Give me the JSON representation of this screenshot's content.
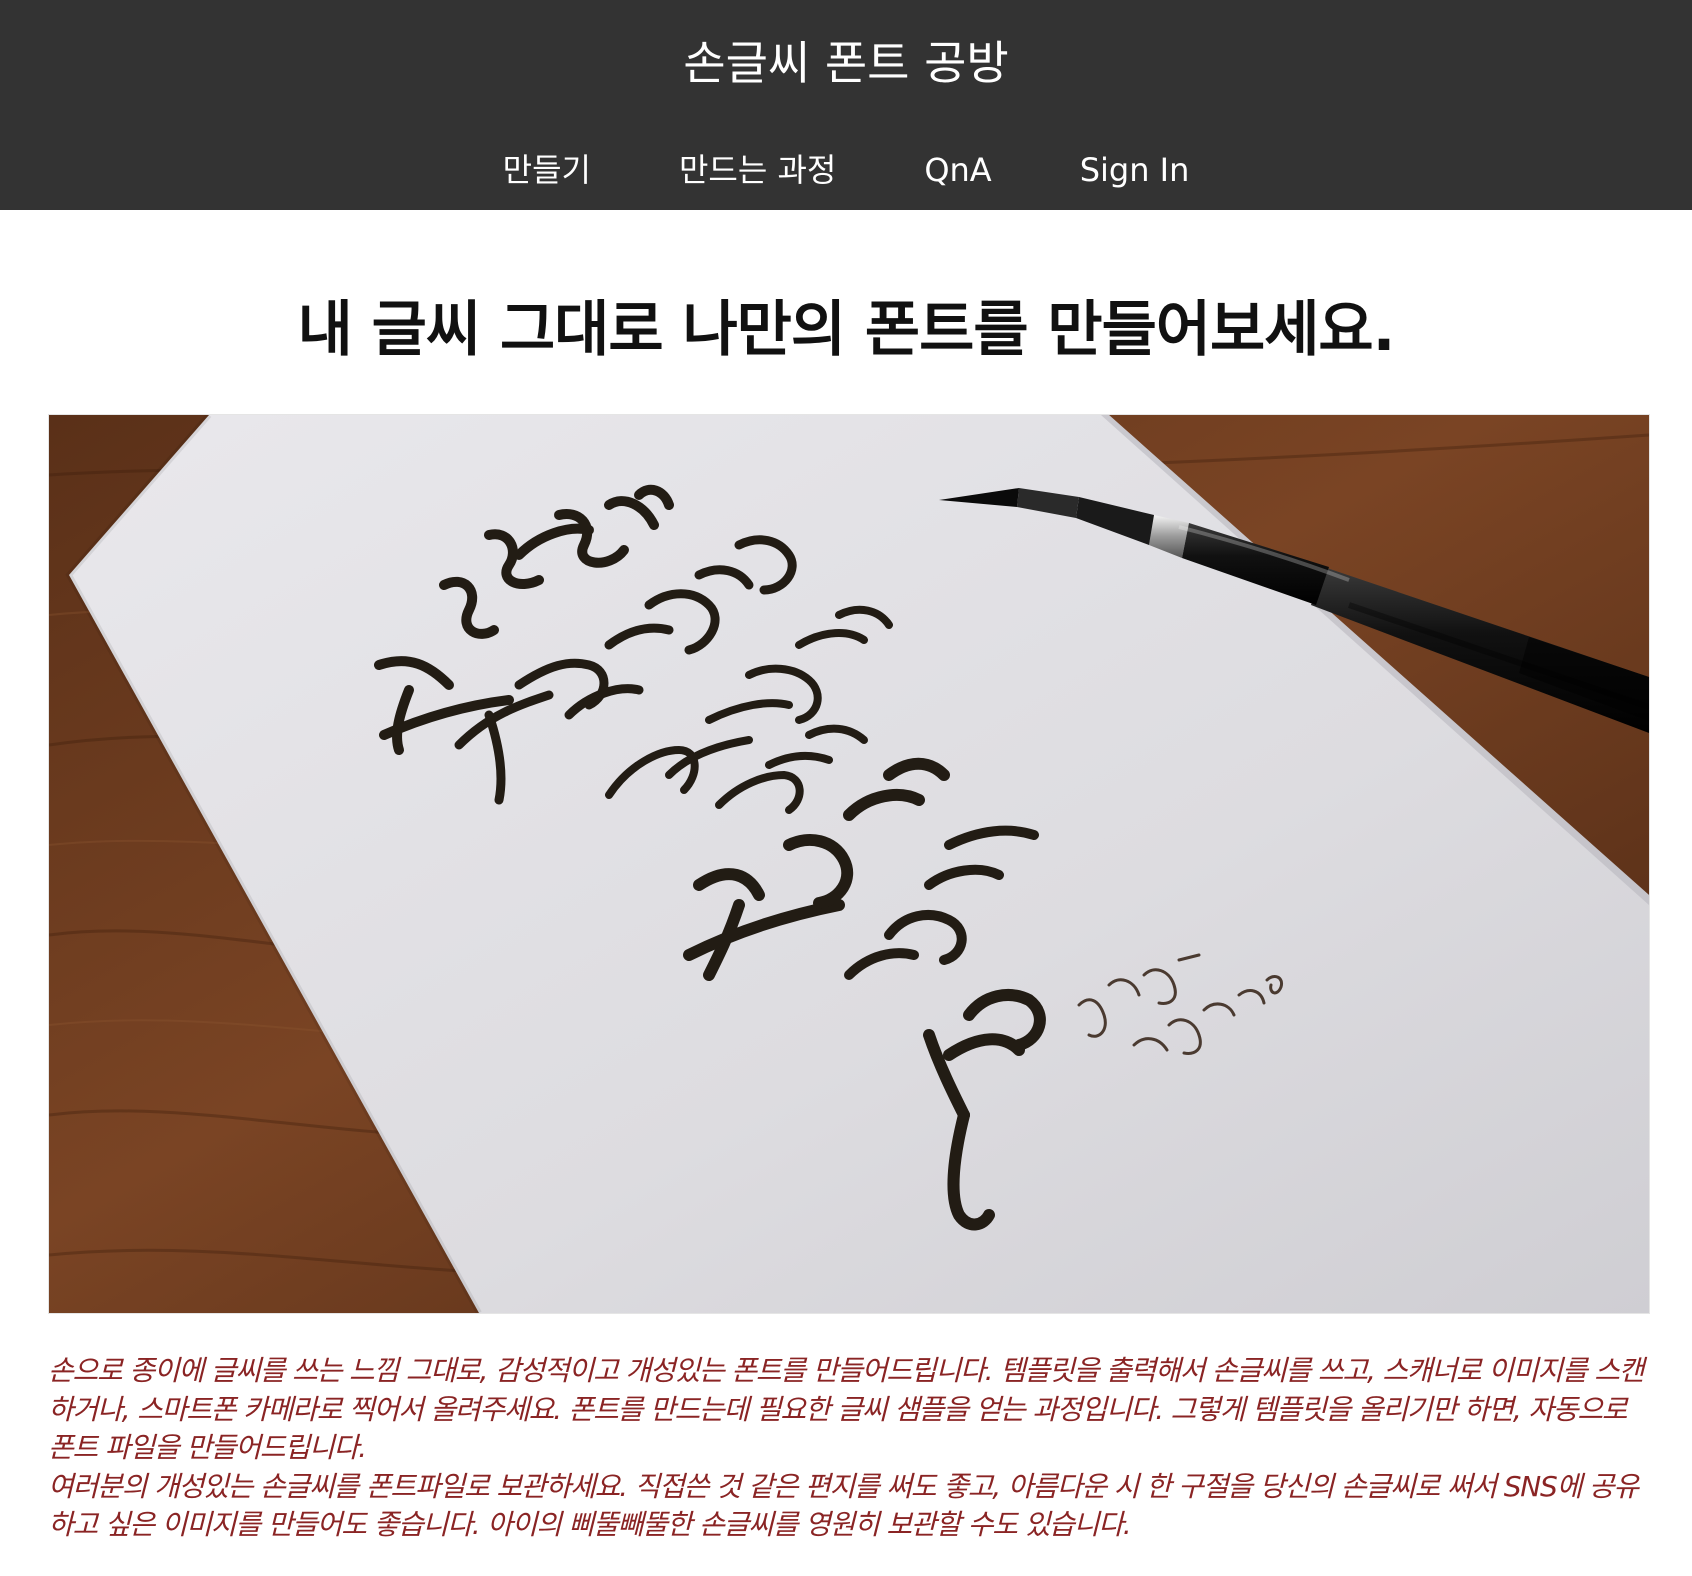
{
  "header": {
    "brand": "손글씨 폰트 공방",
    "nav": [
      {
        "label": "만들기"
      },
      {
        "label": "만드는 과정"
      },
      {
        "label": "QnA"
      },
      {
        "label": "Sign In"
      }
    ]
  },
  "main": {
    "headline": "내 글씨 그대로 나만의 폰트를 만들어보세요.",
    "hero_image": {
      "handwritten_lines": [
        "눈은 살아있다",
        "죽음을 잊어버린",
        "영혼과 육체를",
        "위하여",
        "눈은 새벽이",
        "지나도록",
        "살아있다"
      ],
      "signature": [
        "김수영_눈",
        "누시드캘리"
      ]
    },
    "description": [
      "손으로 종이에 글씨를 쓰는 느낌 그대로, 감성적이고 개성있는 폰트를 만들어드립니다. 템플릿을 출력해서 손글씨를 쓰고, 스캐너로 이미지를 스캔하거나, 스마트폰 카메라로 찍어서 올려주세요. 폰트를 만드는데 필요한 글씨 샘플을 얻는 과정입니다. 그렇게 템플릿을 올리기만 하면, 자동으로 폰트 파일을 만들어드립니다.",
      "여러분의 개성있는 손글씨를 폰트파일로 보관하세요. 직접쓴 것 같은 편지를 써도 좋고, 아름다운 시 한 구절을 당신의 손글씨로 써서 SNS에 공유하고 싶은 이미지를 만들어도 좋습니다. 아이의 삐뚤빼뚤한 손글씨를 영원히 보관할 수도 있습니다."
    ]
  },
  "colors": {
    "navbar_bg": "#333333",
    "description_text": "#8a2424"
  }
}
